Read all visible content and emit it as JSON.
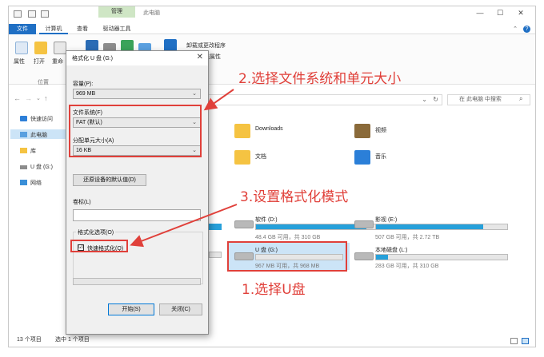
{
  "window": {
    "context_tab": "管理",
    "title": "此电脑",
    "controls": [
      "—",
      "☐",
      "✕"
    ]
  },
  "ribbon": {
    "tabs": [
      "文件",
      "计算机",
      "查看",
      "驱动器工具"
    ],
    "items": [
      {
        "label": "属性",
        "icon": "properties-icon"
      },
      {
        "label": "打开",
        "icon": "open-folder-icon"
      },
      {
        "label": "重命",
        "icon": "rename-icon"
      }
    ],
    "right_items": [
      "卸载或更改程序",
      "统属性"
    ],
    "group_label": "位置"
  },
  "address": {
    "search_placeholder": "在 此电脑 中搜索"
  },
  "nav_pane": [
    {
      "label": "快速访问",
      "icon": "star-icon"
    },
    {
      "label": "此电脑",
      "icon": "computer-icon",
      "selected": true
    },
    {
      "label": "库",
      "icon": "library-icon"
    },
    {
      "label": "U 盘 (G:)",
      "icon": "usb-drive-icon"
    },
    {
      "label": "网络",
      "icon": "network-icon"
    }
  ],
  "folders": [
    {
      "label": "Downloads",
      "icon": "downloads-folder-icon"
    },
    {
      "label": "视频",
      "icon": "videos-folder-icon"
    },
    {
      "label": "文档",
      "icon": "documents-folder-icon"
    },
    {
      "label": "音乐",
      "icon": "music-folder-icon"
    }
  ],
  "drives": [
    {
      "name": "软件 (D:)",
      "info": "48.4 GB 可用，共 310 GB",
      "fill": 0.84
    },
    {
      "name": "影视 (E:)",
      "info": "507 GB 可用，共 2.72 TB",
      "fill": 0.82
    },
    {
      "name": "U 盘 (G:)",
      "info": "967 MB 可用，共 968 MB",
      "fill": 0.0
    },
    {
      "name": "本地磁盘 (L:)",
      "info": "283 GB 可用，共 310 GB",
      "fill": 0.09
    }
  ],
  "status": {
    "count": "13 个项目",
    "selected": "选中 1 个项目"
  },
  "dialog": {
    "title": "格式化 U 盘 (G:)",
    "capacity_label": "容量(P):",
    "capacity_value": "969 MB",
    "fs_label": "文件系统(F)",
    "fs_value": "FAT (默认)",
    "alloc_label": "分配单元大小(A)",
    "alloc_value": "16 KB",
    "restore_button": "还原设备的默认值(D)",
    "volume_label": "卷标(L)",
    "volume_value": "",
    "options_label": "格式化选项(O)",
    "quick_format_label": "快速格式化(Q)",
    "quick_format_checked": "☑",
    "start_button": "开始(S)",
    "close_button": "关闭(C)"
  },
  "annotations": {
    "step1": "1.选择U盘",
    "step2": "2.选择文件系统和单元大小",
    "step3": "3.设置格式化模式",
    "color": "#e0403a"
  }
}
